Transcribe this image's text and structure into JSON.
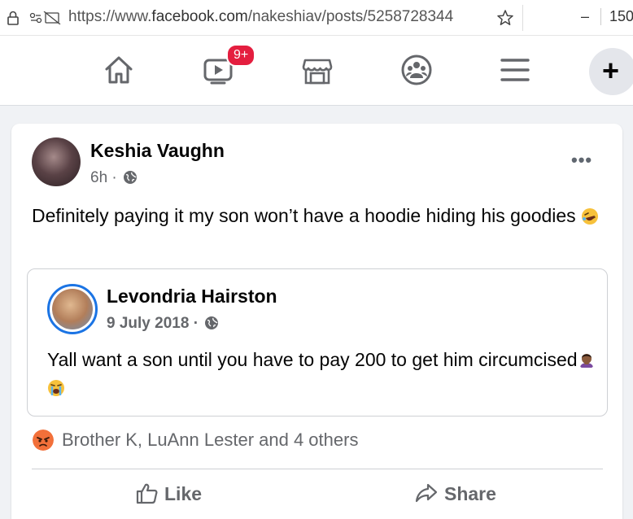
{
  "browser": {
    "url_prefix": "https://www.",
    "url_domain": "facebook.com",
    "url_path": "/nakeshiav/posts/5258728344",
    "minimize": "–",
    "zoom": "150"
  },
  "nav": {
    "icons": [
      "home-icon",
      "watch-icon",
      "marketplace-icon",
      "groups-icon",
      "menu-icon",
      "create-icon"
    ],
    "watch_badge": "9+",
    "plus": "+"
  },
  "post": {
    "author": "Keshia Vaughn",
    "time": "6h ·",
    "text": "Definitely paying it my son won’t have a hoodie hiding his goodies",
    "more": "•••",
    "shared": {
      "author": "Levondria Hairston",
      "date": "9 July 2018 ·",
      "text": "Yall want a son until you have to pay 200 to get him circumcised"
    },
    "reactions": "Brother K, LuAnn Lester and 4 others",
    "actions": {
      "like": "Like",
      "share": "Share"
    }
  },
  "colors": {
    "badge": "#e41e3f",
    "accent": "#1b74e4",
    "secondary_text": "#65676b"
  }
}
